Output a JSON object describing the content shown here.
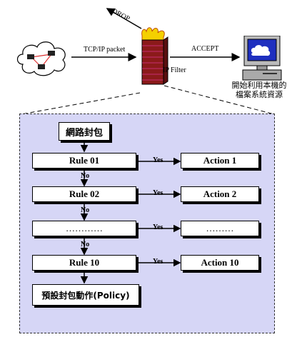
{
  "network": {
    "drop_label": "DROP",
    "packet_label": "TCP/IP packet",
    "accept_label": "ACCEPT",
    "filter_label": "IP Filter",
    "computer_caption_line1": "開始利用本機的",
    "computer_caption_line2": "檔案系統資源"
  },
  "flow": {
    "start": "網路封包",
    "rules": [
      {
        "rule": "Rule 01",
        "action": "Action 1"
      },
      {
        "rule": "Rule 02",
        "action": "Action 2"
      },
      {
        "rule": "…………",
        "action": "………"
      },
      {
        "rule": "Rule 10",
        "action": "Action 10"
      }
    ],
    "yes_label": "Yes",
    "no_label": "No",
    "policy": "預設封包動作(Policy)"
  }
}
